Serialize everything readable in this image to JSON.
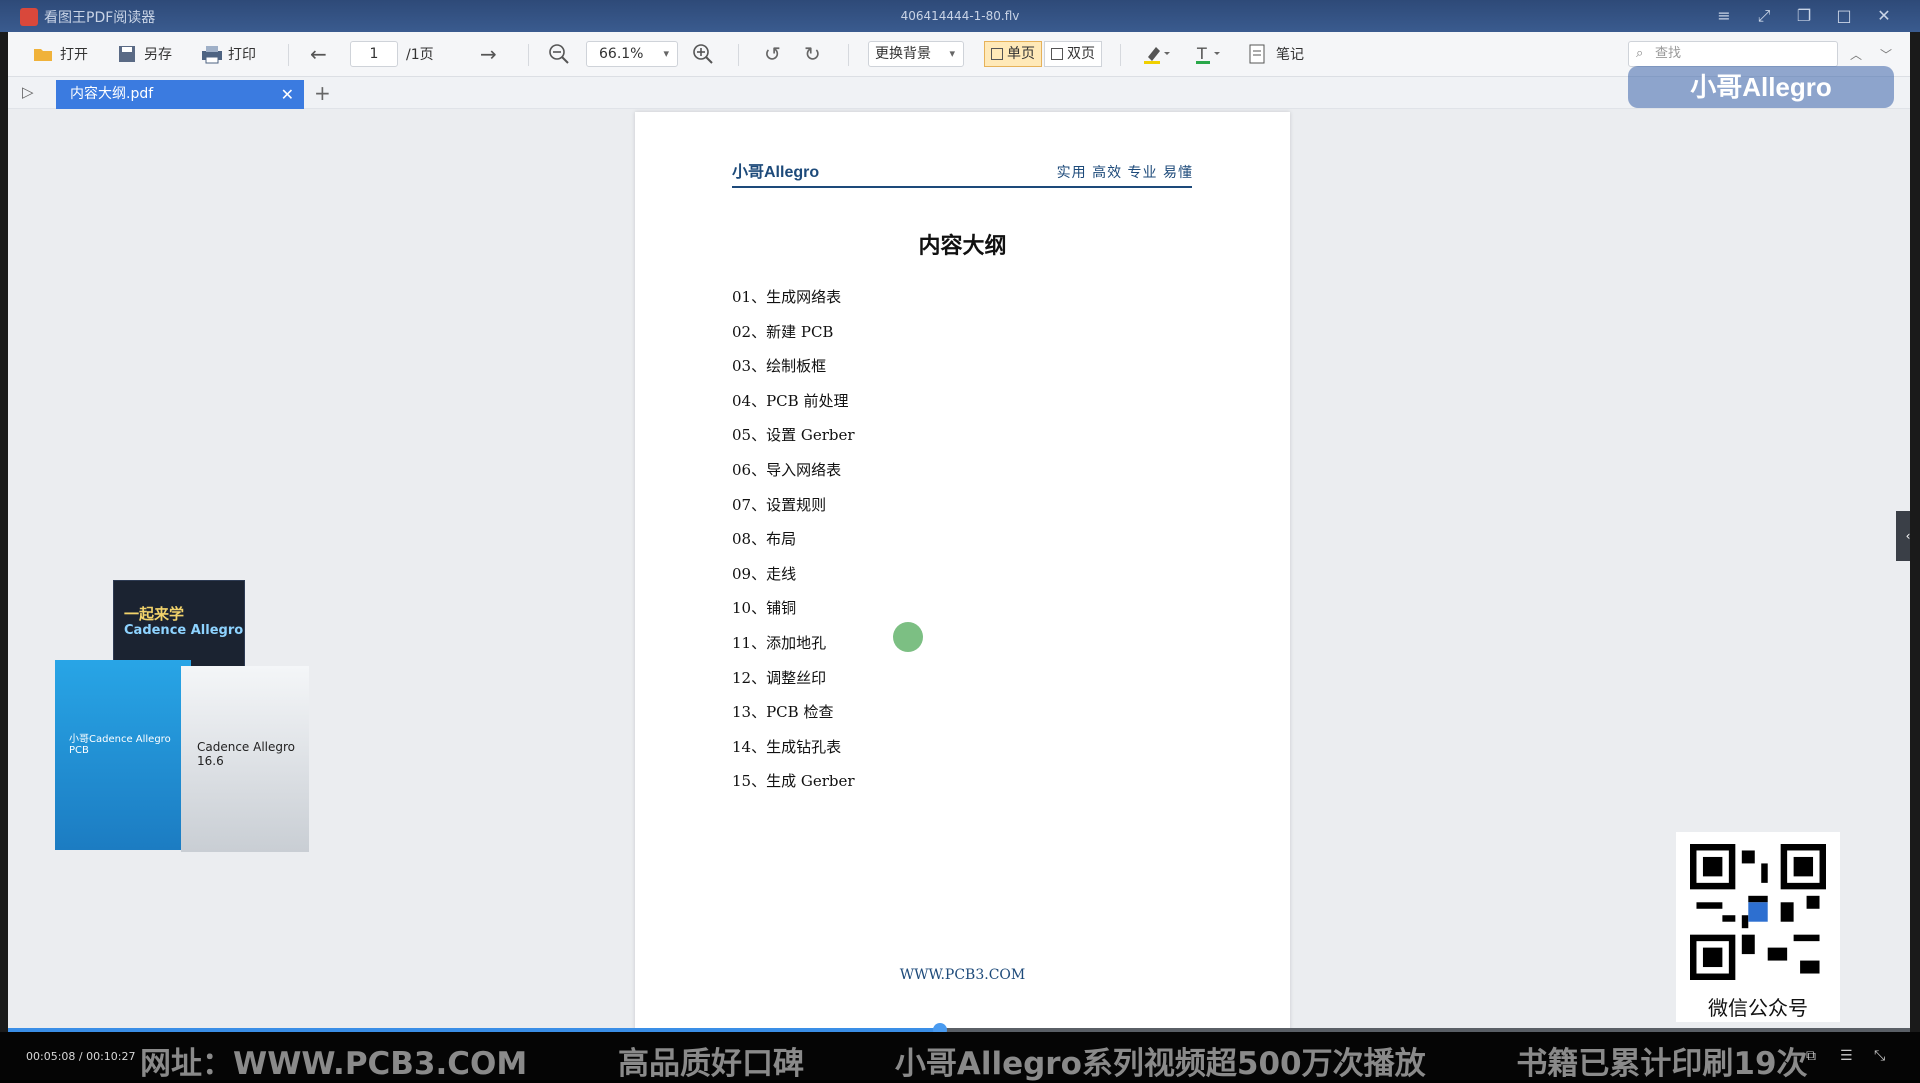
{
  "window": {
    "app_title": "看图王PDF阅读器",
    "video_title": "406414444-1-80.flv"
  },
  "toolbar": {
    "open_label": "打开",
    "saveas_label": "另存",
    "print_label": "打印",
    "page_current": "1",
    "page_total": "/1页",
    "zoom": "66.1%",
    "background_label": "更换背景",
    "single_page_label": "单页",
    "double_page_label": "双页",
    "notes_label": "笔记",
    "search_placeholder": "查找"
  },
  "tabs": [
    {
      "label": "内容大纲.pdf",
      "active": true
    }
  ],
  "document": {
    "header_logo": "小哥Allegro",
    "header_tags": "实用 高效 专业 易懂",
    "title": "内容大纲",
    "outline": [
      "01、生成网络表",
      "02、新建 PCB",
      "03、绘制板框",
      "04、PCB 前处理",
      "05、设置 Gerber",
      "06、导入网络表",
      "07、设置规则",
      "08、布局",
      "09、走线",
      "10、铺铜",
      "11、添加地孔",
      "12、调整丝印",
      "13、PCB 检查",
      "14、生成钻孔表",
      "15、生成 Gerber"
    ],
    "footer": "WWW.PCB3.COM"
  },
  "overlay": {
    "brand_logo": "小哥Allegro",
    "book1_line1": "一起来学",
    "book1_line2": "Cadence Allegro",
    "book2_title": "小哥Cadence Allegro PCB",
    "book3_title": "Cadence Allegro 16.6",
    "qr_label": "微信公众号"
  },
  "player": {
    "timecode": "00:05:08 / 00:10:27",
    "progress": 0.49,
    "marquee": [
      "网址：WWW.PCB3.COM",
      "高品质好口碑",
      "小哥Allegro系列视频超500万次播放",
      "书籍已累计印刷19次"
    ]
  },
  "colors": {
    "accent": "#3b7be0",
    "titlebar": "#2e4a78",
    "doc_brand": "#1d4a7a"
  }
}
